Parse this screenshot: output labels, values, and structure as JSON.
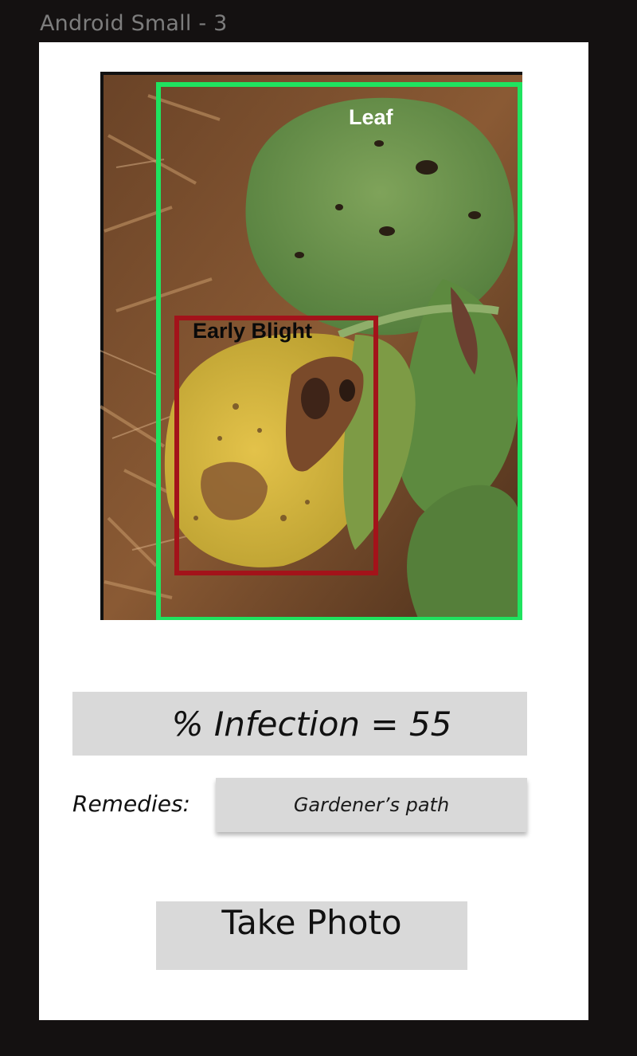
{
  "frame": {
    "title": "Android Small - 3"
  },
  "detections": {
    "leaf": {
      "label": "Leaf",
      "color": "#1fe35f"
    },
    "disease": {
      "label": "Early Blight",
      "color": "#a3131a"
    }
  },
  "infection": {
    "text": "% Infection = 55",
    "value": 55
  },
  "remedies": {
    "label": "Remedies:",
    "option": "Gardener’s path"
  },
  "actions": {
    "take_photo_label": "Take Photo"
  }
}
